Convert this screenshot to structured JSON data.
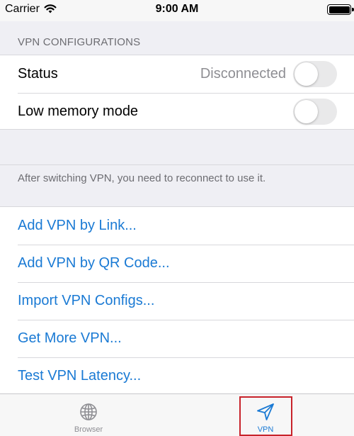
{
  "status_bar": {
    "carrier": "Carrier",
    "time": "9:00 AM"
  },
  "section_header": "VPN CONFIGURATIONS",
  "settings": {
    "status_label": "Status",
    "status_value": "Disconnected",
    "status_toggle_on": false,
    "low_memory_label": "Low memory mode",
    "low_memory_toggle_on": false
  },
  "footer_note": "After switching VPN, you need to reconnect to use it.",
  "actions": [
    {
      "label": "Add VPN by Link..."
    },
    {
      "label": "Add VPN by QR Code..."
    },
    {
      "label": "Import VPN Configs..."
    },
    {
      "label": "Get More VPN..."
    },
    {
      "label": "Test VPN Latency..."
    }
  ],
  "tabbar": {
    "tabs": [
      {
        "label": "Browser",
        "icon": "globe-icon",
        "selected": false
      },
      {
        "label": "VPN",
        "icon": "location-arrow-icon",
        "selected": true
      }
    ]
  },
  "colors": {
    "accent": "#1a7ad4",
    "highlight_box": "#c8232b",
    "secondary_text": "#8e8e93"
  }
}
